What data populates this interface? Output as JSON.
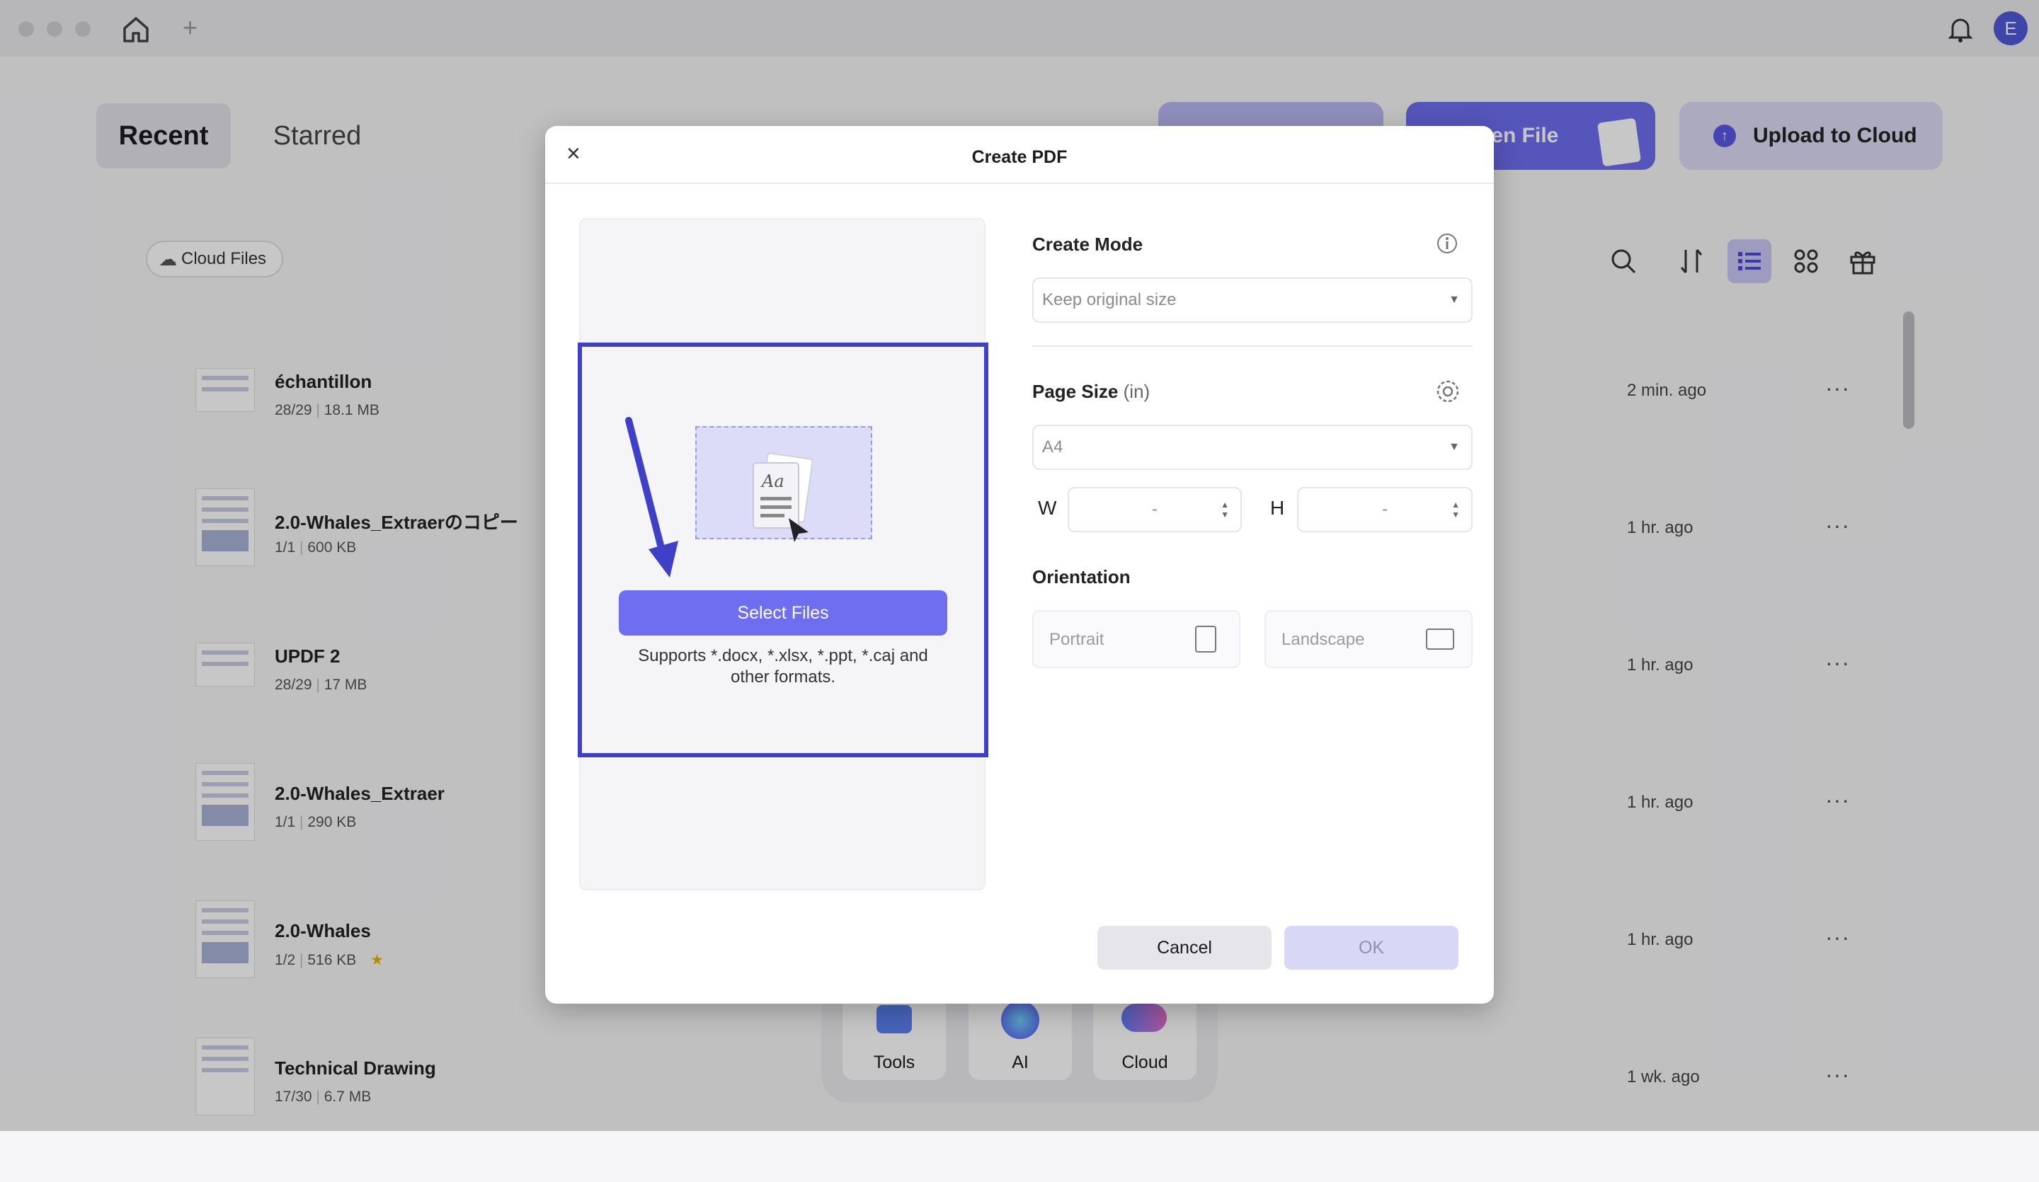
{
  "titlebar": {
    "avatar_initial": "E"
  },
  "tabs": [
    {
      "label": "Recent"
    },
    {
      "label": "Starred"
    }
  ],
  "header_buttons": {
    "open_file": "pen File",
    "upload": "Upload to Cloud"
  },
  "filter": {
    "cloud_files": "Cloud Files"
  },
  "files": [
    {
      "name": "échantillon",
      "pages": "28/29",
      "size": "18.1 MB",
      "time": "2 min. ago",
      "more": "···"
    },
    {
      "name": "2.0-Whales_Extraerのコピー",
      "pages": "1/1",
      "size": "600 KB",
      "time": "1 hr. ago",
      "more": "···"
    },
    {
      "name": "UPDF 2",
      "pages": "28/29",
      "size": "17 MB",
      "time": "1 hr. ago",
      "more": "···"
    },
    {
      "name": "2.0-Whales_Extraer",
      "pages": "1/1",
      "size": "290 KB",
      "time": "1 hr. ago",
      "more": "···"
    },
    {
      "name": "2.0-Whales",
      "pages": "1/2",
      "size": "516 KB",
      "time": "1 hr. ago",
      "more": "···"
    },
    {
      "name": "Technical Drawing",
      "pages": "17/30",
      "size": "6.7 MB",
      "time": "1 wk. ago",
      "more": "···"
    }
  ],
  "dock": [
    {
      "label": "Tools"
    },
    {
      "label": "AI"
    },
    {
      "label": "Cloud"
    }
  ],
  "dialog": {
    "title": "Create PDF",
    "close": "×",
    "select_files": "Select Files",
    "supports_line1": "Supports *.docx, *.xlsx, *.ppt, *.caj and",
    "supports_line2": "other formats.",
    "create_mode_label": "Create Mode",
    "create_mode_value": "Keep original size",
    "page_size_label": "Page Size",
    "page_size_unit": "(in)",
    "page_size_value": "A4",
    "w_label": "W",
    "h_label": "H",
    "w_value": "-",
    "h_value": "-",
    "orientation_label": "Orientation",
    "portrait": "Portrait",
    "landscape": "Landscape",
    "cancel": "Cancel",
    "ok": "OK"
  },
  "colors": {
    "accent": "#6f6ef0",
    "highlight": "#3f3fc8"
  }
}
